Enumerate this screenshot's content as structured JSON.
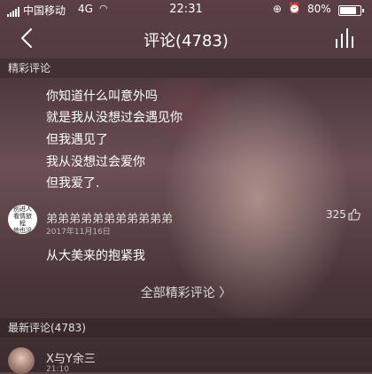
{
  "status_bar": {
    "carrier": "中国移动",
    "network": "4G",
    "time": "22:31",
    "battery_percent": "80%",
    "battery_level": 0.8
  },
  "nav": {
    "title": "评论(4783)"
  },
  "hot_section": {
    "header": "精彩评论",
    "featured_lines": [
      "你知道什么叫意外吗",
      "就是我从没想过会遇见你",
      "但我遇见了",
      "我从没想过会爱你",
      "但我爱了."
    ],
    "comment": {
      "avatar_text": "别进人\n看情旅程\n他也没",
      "author": "弟弟弟弟弟弟弟弟弟弟弟",
      "date": "2017年11月16日",
      "likes": "325",
      "text": "从大美来的抱紧我"
    },
    "all_link": "全部精彩评论 〉"
  },
  "latest_section": {
    "header": "最新评论(4783)",
    "comment": {
      "author": "X与Y余三",
      "time": "21:10"
    }
  }
}
